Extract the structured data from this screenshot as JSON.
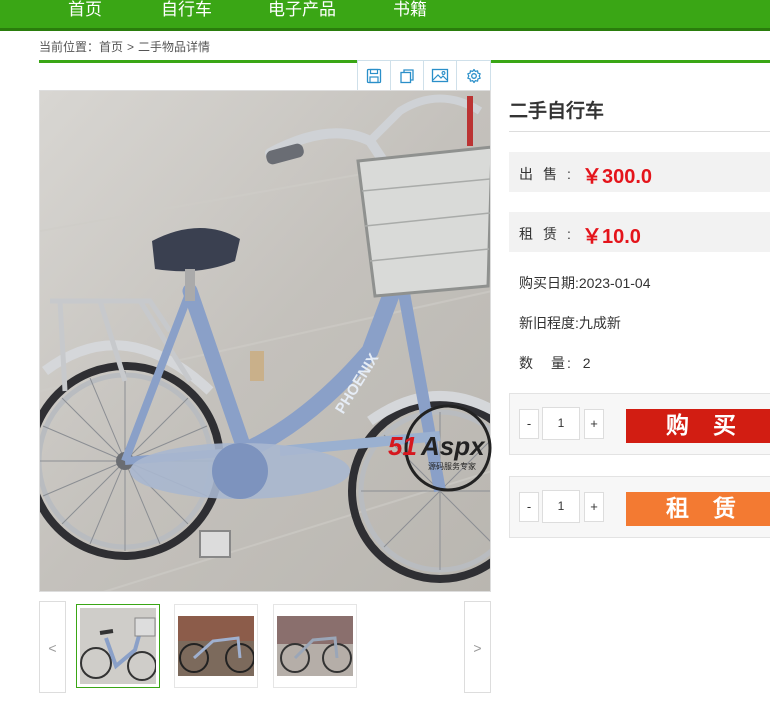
{
  "nav": {
    "items": [
      "首页",
      "自行车",
      "电子产品",
      "书籍"
    ]
  },
  "breadcrumb": {
    "prefix": "当前位置：",
    "home": "首页",
    "separator": ">",
    "current": "二手物品详情"
  },
  "toolbar": {
    "icons": [
      "save-icon",
      "copy-icon",
      "image-icon",
      "settings-icon"
    ]
  },
  "thumbnails": {
    "prev": "<",
    "next": ">",
    "count": 3,
    "active_index": 0
  },
  "product": {
    "title": "二手自行车",
    "sale_label": "出售:",
    "sale_price": "￥300.0",
    "rent_label": "租赁:",
    "rent_price": "￥10.0",
    "purchase_date": "购买日期:2023-01-04",
    "condition": "新旧程度:九成新",
    "quantity_label": "数　量:",
    "quantity_value": "2"
  },
  "buy_box": {
    "minus": "-",
    "qty": "1",
    "plus": "+",
    "button": "购买"
  },
  "rent_box": {
    "minus": "-",
    "qty": "1",
    "plus": "+",
    "button": "租赁"
  },
  "watermark": {
    "logo": "51Aspx",
    "tagline": "源码服务专家"
  },
  "colors": {
    "brand_green": "#3aa615",
    "price_red": "#e4141b",
    "buy_red": "#d21d12",
    "rent_orange": "#f37a32"
  }
}
